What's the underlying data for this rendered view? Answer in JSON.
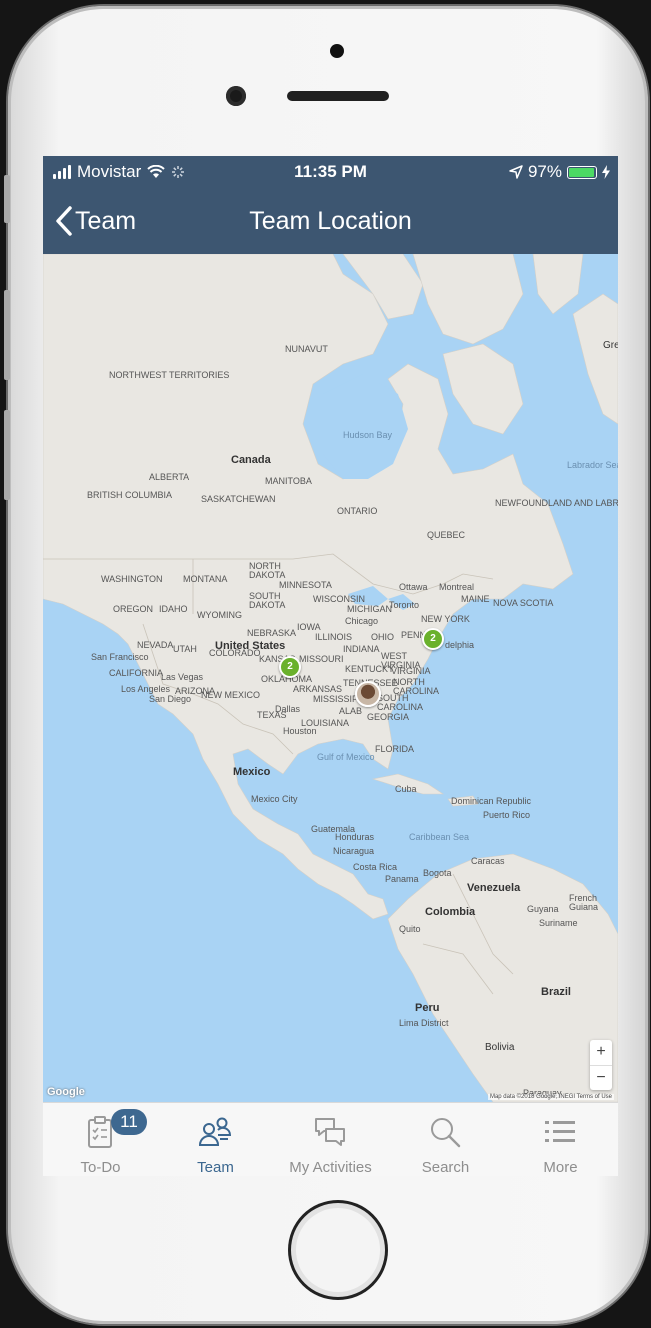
{
  "status_bar": {
    "carrier": "Movistar",
    "time": "11:35 PM",
    "battery": "97%",
    "battery_level": 0.97
  },
  "nav": {
    "back_label": "Team",
    "title": "Team Location"
  },
  "map": {
    "labels": {
      "canada": "Canada",
      "united_states": "United States",
      "mexico": "Mexico",
      "venezuela": "Venezuela",
      "colombia": "Colombia",
      "peru": "Peru",
      "brazil": "Brazil",
      "bolivia": "Bolivia",
      "hudson_bay": "Hudson Bay",
      "gulf_of_mexico": "Gulf of Mexico",
      "caribbean_sea": "Caribbean Sea",
      "cuba": "Cuba",
      "guatemala": "Guatemala",
      "honduras": "Honduras",
      "nicaragua": "Nicaragua",
      "costa_rica": "Costa Rica",
      "panama": "Panama",
      "san_francisco": "San Francisco",
      "los_angeles": "Los Angeles",
      "las_vegas": "Las Vegas",
      "san_diego": "San Diego",
      "chicago": "Chicago",
      "toronto": "Toronto",
      "ottawa": "Ottawa",
      "montreal": "Montreal",
      "new_york": "NEW YORK",
      "dallas": "Dallas",
      "houston": "Houston",
      "mexico_city": "Mexico City",
      "bogota": "Bogota",
      "quito": "Quito",
      "caracas": "Caracas",
      "lima": "Lima District",
      "paraguay": "Paraguay",
      "quebec": "QUEBEC",
      "ontario": "ONTARIO",
      "manitoba": "MANITOBA",
      "saskatchewan": "SASKATCHEWAN",
      "alberta": "ALBERTA",
      "british_columbia": "BRITISH COLUMBIA",
      "nunavut": "NUNAVUT",
      "northwest_territories": "NORTHWEST TERRITORIES",
      "newfoundland": "NEWFOUNDLAND AND LABRADOR",
      "greenland": "Gre",
      "labrador_sea": "Labrador Sea",
      "washington": "WASHINGTON",
      "oregon": "OREGON",
      "idaho": "IDAHO",
      "montana": "MONTANA",
      "wyoming": "WYOMING",
      "nevada": "NEVADA",
      "utah": "UTAH",
      "colorado": "COLORADO",
      "california": "CALIFORNIA",
      "arizona": "ARIZONA",
      "new_mexico": "NEW MEXICO",
      "texas": "TEXAS",
      "kansas": "KANSAS",
      "oklahoma": "OKLAHOMA",
      "missouri": "MISSOURI",
      "arkansas": "ARKANSAS",
      "louisiana": "LOUISIANA",
      "iowa": "IOWA",
      "nebraska": "NEBRASKA",
      "minnesota": "MINNESOTA",
      "wisconsin": "WISCONSIN",
      "michigan": "MICHIGAN",
      "illinois": "ILLINOIS",
      "indiana": "INDIANA",
      "ohio": "OHIO",
      "kentucky": "KENTUCKY",
      "tennessee": "TENNESSEE",
      "mississippi": "MISSISSIPPI",
      "alabama": "ALAB",
      "georgia": "GEORGIA",
      "florida": "FLORIDA",
      "north_carolina": "NORTH CAROLINA",
      "south_carolina": "SOUTH CAROLINA",
      "virginia": "VIRGINIA",
      "west_virginia": "WEST VIRGINIA",
      "penn": "PENN",
      "north_dakota": "NORTH DAKOTA",
      "south_dakota": "SOUTH DAKOTA",
      "nova_scotia": "NOVA SCOTIA",
      "maine": "MAINE",
      "guyana": "Guyana",
      "suriname": "Suriname",
      "french_guiana": "French Guiana",
      "dominican_republic": "Dominican Republic",
      "puerto_rico": "Puerto Rico",
      "philadelphia": "delphia",
      "google": "Google",
      "attribution": "Map data ©2018 Google, INEGI   Terms of Use"
    },
    "clusters": [
      {
        "count": "2",
        "region": "central-us"
      },
      {
        "count": "2",
        "region": "east-coast"
      }
    ],
    "zoom_in": "+",
    "zoom_out": "−"
  },
  "tabs": [
    {
      "label": "To-Do",
      "icon": "clipboard-icon",
      "badge": "11"
    },
    {
      "label": "Team",
      "icon": "team-icon",
      "active": true
    },
    {
      "label": "My Activities",
      "icon": "chat-bubbles-icon"
    },
    {
      "label": "Search",
      "icon": "search-icon"
    },
    {
      "label": "More",
      "icon": "list-icon"
    }
  ],
  "colors": {
    "header": "#3d5671",
    "accent": "#3e6890",
    "cluster": "#6ab12c",
    "water": "#a9d3f4",
    "land": "#e9e7e2"
  }
}
